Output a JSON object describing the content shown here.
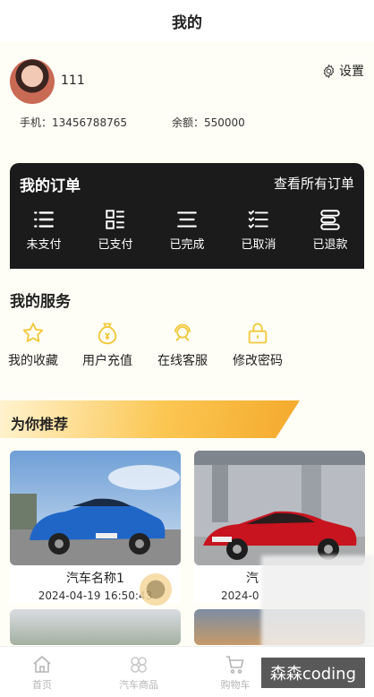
{
  "header": {
    "title": "我的"
  },
  "profile": {
    "username": "111",
    "settings_label": "设置",
    "phone": "手机：13456788765",
    "balance": "余额：550000"
  },
  "orders": {
    "title": "我的订单",
    "view_all": "查看所有订单",
    "items": [
      {
        "label": "未支付",
        "icon": "list-icon"
      },
      {
        "label": "已支付",
        "icon": "grid-list-icon"
      },
      {
        "label": "已完成",
        "icon": "lines-icon"
      },
      {
        "label": "已取消",
        "icon": "checklist-icon"
      },
      {
        "label": "已退款",
        "icon": "stack-icon"
      }
    ]
  },
  "services": {
    "title": "我的服务",
    "items": [
      {
        "label": "我的收藏",
        "icon": "star-icon"
      },
      {
        "label": "用户充值",
        "icon": "money-bag-icon"
      },
      {
        "label": "在线客服",
        "icon": "support-icon"
      },
      {
        "label": "修改密码",
        "icon": "lock-icon"
      }
    ]
  },
  "recommend": {
    "title": "为你推荐",
    "cards": [
      {
        "name": "汽车名称1",
        "date": "2024-04-19 16:50:43"
      },
      {
        "name": "汽",
        "date": "2024-0"
      }
    ]
  },
  "tabbar": {
    "items": [
      {
        "label": "首页",
        "icon": "home-icon"
      },
      {
        "label": "汽车商品",
        "icon": "clover-icon"
      },
      {
        "label": "购物车",
        "icon": "cart-icon"
      }
    ]
  },
  "watermark": "森森coding",
  "colors": {
    "accent": "#fbc651",
    "order_bg": "#1b1b1b",
    "service_icon": "#f3c93b"
  }
}
